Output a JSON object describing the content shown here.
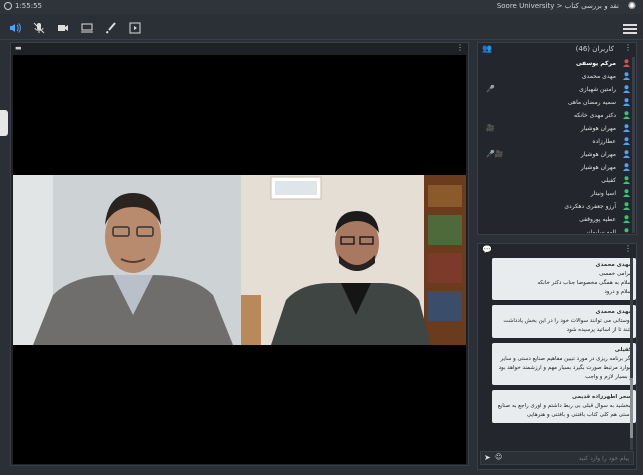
{
  "topbar": {
    "time": "1:55:55",
    "title": "Soore University > نقد و بررسی کتاب"
  },
  "toolbar": {
    "icons": [
      "speaker-icon",
      "mic-off-icon",
      "camera-icon",
      "screen-share-icon",
      "brush-icon",
      "media-icon"
    ]
  },
  "users": {
    "header": "کاربران (46)",
    "list": [
      {
        "name": "مرکم یوسفی",
        "color": "#e04b4b",
        "me": true
      },
      {
        "name": "مهدی محمدی",
        "color": "#4da3ff"
      },
      {
        "name": "رامتین شهبازی",
        "color": "#4da3ff",
        "extra": "🎤"
      },
      {
        "name": "سمیه رمضان ماهی",
        "color": "#4da3ff"
      },
      {
        "name": "دکتر مهدی خانکه",
        "color": "#2ecc71"
      },
      {
        "name": "مهران هوشیار",
        "color": "#4da3ff",
        "extra": "🎥"
      },
      {
        "name": "عطارزاده",
        "color": "#4da3ff"
      },
      {
        "name": "مهران هوشیار",
        "color": "#4da3ff",
        "extra": "🎤🎥"
      },
      {
        "name": "مهران هوشیار",
        "color": "#4da3ff"
      },
      {
        "name": "کفیلی",
        "color": "#2ecc71"
      },
      {
        "name": "اسیا ونیتار",
        "color": "#2ecc71"
      },
      {
        "name": "آرزو جعفری دهکردی",
        "color": "#2ecc71"
      },
      {
        "name": "عطیه پوروقفی",
        "color": "#2ecc71"
      },
      {
        "name": "الهه سلیمانی",
        "color": "#2ecc71"
      },
      {
        "name": "فاطمه السادات سجادی",
        "color": "#2ecc71"
      }
    ]
  },
  "chat": {
    "messages": [
      {
        "author": "مهدی محمدی",
        "text": "سلام و درود"
      },
      {
        "author": "مهدی محمدی",
        "text": "دوستانی می توانند سوالات خود را در این بخش یادداشت کنند تا از اساتید پرسیده شود"
      },
      {
        "author": "کفیلی",
        "text": "اگر برنامه ریزی در مورد تبیین مفاهیم صنایع دستی و سایر موارد مرتبط صورت بگیرد بسیار مهم و ارزشمند خواهد بود و بسیار لازم و واجب"
      },
      {
        "author": "سحر اطهرزاده قدیمی",
        "text": "ببخشید به سوال قبلی بی ربط داشتم و اوری راجع به صنایع دستی هم کلی کتاب بافتنی و بافتنی و هنرهایی"
      }
    ],
    "placeholder": "پیام خود را وارد کنید",
    "greeting": "مرامی خمسی",
    "greeting2": "سلام به همگی مخصوصا جناب دکتر خانکه"
  }
}
